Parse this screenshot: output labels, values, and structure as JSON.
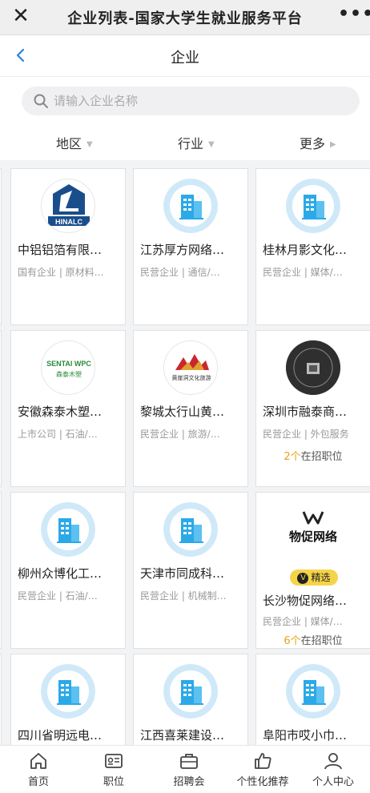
{
  "window": {
    "title": "企业列表-国家大学生就业服务平台",
    "close_icon": "close-icon",
    "more_icon": "more-icon"
  },
  "nav": {
    "title": "企业",
    "back_icon": "chevron-left-icon"
  },
  "search": {
    "placeholder": "请输入企业名称"
  },
  "filters": [
    {
      "label": "地区",
      "caret": "▼"
    },
    {
      "label": "行业",
      "caret": "▼"
    },
    {
      "label": "更多",
      "caret": "▶"
    }
  ],
  "companies": [
    {
      "name": "中铝铝箔有限…",
      "tags": "国有企业 | 原材料…",
      "logo": "chalco-logo",
      "jobs_count": "",
      "jobs_label": "",
      "badge": ""
    },
    {
      "name": "江苏厚方网络…",
      "tags": "民营企业 | 通信/…",
      "logo": "building-icon",
      "jobs_count": "",
      "jobs_label": "",
      "badge": ""
    },
    {
      "name": "桂林月影文化…",
      "tags": "民营企业 | 媒体/…",
      "logo": "building-icon",
      "jobs_count": "",
      "jobs_label": "",
      "badge": ""
    },
    {
      "name": "安徽森泰木塑…",
      "tags": "上市公司 | 石油/…",
      "logo": "sentai-logo",
      "logo_text": "SENTAI WPC",
      "logo_sub": "森泰木塑",
      "jobs_count": "",
      "jobs_label": "",
      "badge": ""
    },
    {
      "name": "黎城太行山黄…",
      "tags": "民营企业 | 旅游/…",
      "logo": "huangyadong-logo",
      "logo_text": "黄崖洞文化旅游",
      "jobs_count": "",
      "jobs_label": "",
      "badge": ""
    },
    {
      "name": "深圳市融泰商…",
      "tags": "民营企业 | 外包服务",
      "logo": "rongtai-logo",
      "jobs_count": "2个",
      "jobs_label": "在招职位",
      "badge": ""
    },
    {
      "name": "柳州众博化工…",
      "tags": "民营企业 | 石油/…",
      "logo": "building-icon",
      "jobs_count": "",
      "jobs_label": "",
      "badge": ""
    },
    {
      "name": "天津市同成科…",
      "tags": "民营企业 | 机械制…",
      "logo": "building-icon",
      "jobs_count": "",
      "jobs_label": "",
      "badge": ""
    },
    {
      "name": "长沙物促网络…",
      "tags": "民营企业 | 媒体/…",
      "logo": "wucu-logo",
      "logo_text": "物促网络",
      "jobs_count": "6个",
      "jobs_label": "在招职位",
      "badge": "精选",
      "badge_icon": "V"
    },
    {
      "name": "四川省明远电…",
      "tags": "",
      "logo": "building-icon",
      "jobs_count": "",
      "jobs_label": "",
      "badge": ""
    },
    {
      "name": "江西喜莱建设…",
      "tags": "",
      "logo": "building-icon",
      "jobs_count": "",
      "jobs_label": "",
      "badge": ""
    },
    {
      "name": "阜阳市哎小巾…",
      "tags": "",
      "logo": "building-icon",
      "jobs_count": "",
      "jobs_label": "",
      "badge": ""
    }
  ],
  "tabs": [
    {
      "label": "首页",
      "icon": "home-icon"
    },
    {
      "label": "职位",
      "icon": "id-card-icon"
    },
    {
      "label": "招聘会",
      "icon": "briefcase-icon"
    },
    {
      "label": "个性化推荐",
      "icon": "thumbs-up-icon"
    },
    {
      "label": "个人中心",
      "icon": "user-icon"
    }
  ],
  "colors": {
    "accent": "#2d7ee8",
    "building_bg": "#cfe9f8",
    "building_fg": "#2ba9e8",
    "jobs_number": "#e8a21a",
    "badge": "#f6d44a"
  }
}
